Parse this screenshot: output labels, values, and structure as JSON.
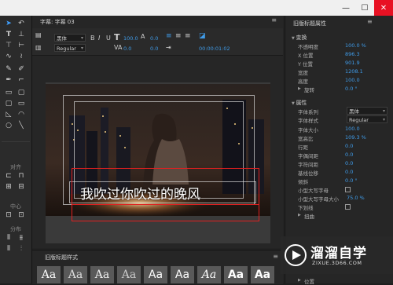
{
  "window": {
    "min": "—",
    "max": "☐",
    "close": "✕"
  },
  "tab": {
    "title": "字幕: 字幕 03",
    "menu_icon": "≡"
  },
  "toolbar": {
    "font_family": "黑体",
    "font_style": "Regular",
    "font_size": "100.0",
    "kerning": "0.0",
    "leading": "0.0",
    "timecode": "00:00:01:02"
  },
  "tools": {
    "align_label": "对齐",
    "center_label": "中心",
    "distribute_label": "分布"
  },
  "caption": {
    "text": "我吹过你吹过的晚风"
  },
  "styles": {
    "label": "旧版标题样式",
    "menu_icon": "≡",
    "swatch_text": "Aa"
  },
  "props": {
    "panel_title": "旧版标题属性",
    "menu_icon": "≡",
    "transform_header": "变换",
    "properties_header": "属性",
    "rows": [
      {
        "k": "不透明度",
        "v": "100.0 %"
      },
      {
        "k": "X 位置",
        "v": "896.3"
      },
      {
        "k": "Y 位置",
        "v": "901.9"
      },
      {
        "k": "宽度",
        "v": "1208.1"
      },
      {
        "k": "高度",
        "v": "100.0"
      },
      {
        "k": "旋转",
        "v": "0.0 °"
      }
    ],
    "prop_rows": [
      {
        "k": "字体系列",
        "v": "黑体"
      },
      {
        "k": "字体样式",
        "v": "Regular"
      },
      {
        "k": "字体大小",
        "v": "100.0"
      },
      {
        "k": "宽高比",
        "v": "109.3 %"
      },
      {
        "k": "行距",
        "v": "0.0"
      },
      {
        "k": "字偶间距",
        "v": "0.0"
      },
      {
        "k": "字符间距",
        "v": "0.0"
      },
      {
        "k": "基线位移",
        "v": "0.0"
      },
      {
        "k": "倾斜",
        "v": "0.0 °"
      },
      {
        "k": "小型大写字母",
        "v": ""
      },
      {
        "k": "小型大写字母大小",
        "v": "75.0 %"
      },
      {
        "k": "下划线",
        "v": ""
      },
      {
        "k": "扭曲",
        "v": ""
      }
    ],
    "position_row": "位置"
  },
  "watermark": {
    "title": "溜溜自学",
    "url": "ZIXUE.3D66.COM"
  }
}
